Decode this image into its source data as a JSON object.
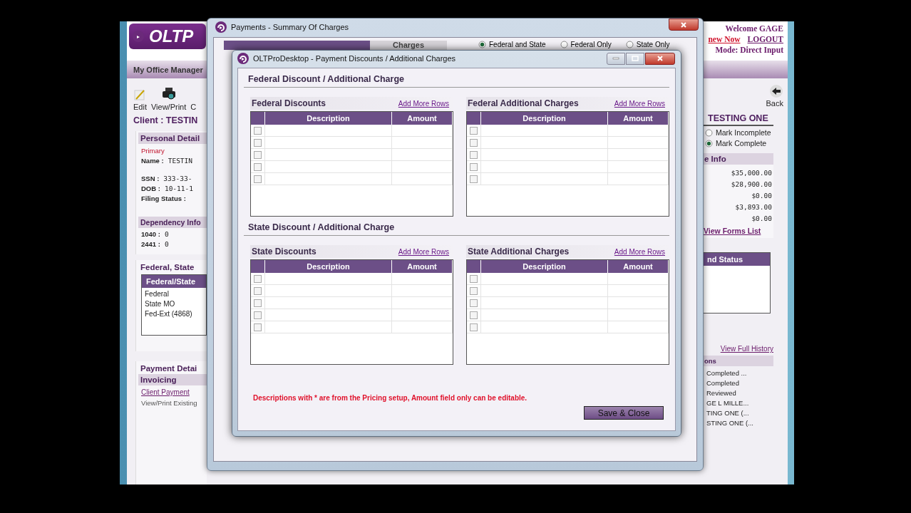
{
  "main": {
    "logo": "OLTP",
    "welcome": "Welcome GAGE",
    "renew_link": "new Now",
    "logout_link": "LOGOUT",
    "mode": "Mode: Direct Input",
    "office_manager": "My Office Manager",
    "toolbar": [
      {
        "label": "Edit",
        "kind": "edit"
      },
      {
        "label": "View/Print",
        "kind": "print"
      },
      {
        "label": "C",
        "kind": "none"
      }
    ],
    "back": "Back",
    "client": "Client : TESTIN",
    "client_name": "TESTING ONE",
    "personal": {
      "title": "Personal Detail",
      "role": "Primary",
      "fields": [
        {
          "label": "Name :",
          "value": "TESTIN"
        },
        {
          "label": "SSN :",
          "value": "333-33-"
        },
        {
          "label": "DOB :",
          "value": "10-11-1"
        },
        {
          "label": "Filing Status :"
        }
      ]
    },
    "dependency": {
      "title": "Dependency Info",
      "rows": [
        {
          "label": "1040 :",
          "value": "0"
        },
        {
          "label": "2441 :",
          "value": "0"
        }
      ]
    },
    "status_options": [
      {
        "label": "Mark Incomplete",
        "selected": false
      },
      {
        "label": "Mark Complete",
        "selected": true
      }
    ],
    "income": {
      "title": "e Info",
      "values": [
        "$35,000.00",
        "$28,900.00",
        "$0.00",
        "$3,893.00",
        "$0.00"
      ],
      "link": "View Forms List"
    },
    "returns": {
      "title": "Federal, State",
      "column": "Federal/State",
      "items": [
        "Federal",
        "State MO",
        "Fed-Ext (4868)"
      ],
      "column_2": "nd Status"
    },
    "payment": {
      "title": "Payment Detai",
      "section": "Invoicing",
      "link": "Client Payment",
      "text": "View/Print Existing"
    },
    "history": {
      "link": "View Full History",
      "title": "ons",
      "items": [
        "Completed ...",
        "Completed",
        "Reviewed",
        "GE L MILLE...",
        "TING ONE (...",
        "STING ONE (..."
      ]
    }
  },
  "summary": {
    "title": "Payments - Summary Of Charges",
    "column": "Charges",
    "options": [
      {
        "label": "Federal and State",
        "selected": true
      },
      {
        "label": "Federal Only",
        "selected": false
      },
      {
        "label": "State Only",
        "selected": false
      }
    ]
  },
  "discounts": {
    "title": "OLTProDesktop - Payment Discounts / Additional Charges",
    "sections": [
      {
        "title": "Federal Discount / Additional Charge",
        "grids": [
          {
            "title": "Federal Discounts",
            "link": "Add More Rows",
            "columns": [
              "Description",
              "Amount"
            ],
            "rows": [
              {
                "checked": false
              },
              {
                "checked": false
              },
              {
                "checked": false
              },
              {
                "checked": false
              },
              {
                "checked": false
              }
            ]
          },
          {
            "title": "Federal Additional Charges",
            "link": "Add More Rows",
            "columns": [
              "Description",
              "Amount"
            ],
            "rows": [
              {
                "checked": false
              },
              {
                "checked": false
              },
              {
                "checked": false
              },
              {
                "checked": false
              },
              {
                "checked": false
              }
            ]
          }
        ]
      },
      {
        "title": "State Discount / Additional Charge",
        "grids": [
          {
            "title": "State Discounts",
            "link": "Add More Rows",
            "columns": [
              "Description",
              "Amount"
            ],
            "rows": [
              {
                "checked": false
              },
              {
                "checked": false
              },
              {
                "checked": false
              },
              {
                "checked": false
              },
              {
                "checked": false
              }
            ]
          },
          {
            "title": "State Additional Charges",
            "link": "Add More Rows",
            "columns": [
              "Description",
              "Amount"
            ],
            "rows": [
              {
                "checked": false
              },
              {
                "checked": false
              },
              {
                "checked": false
              },
              {
                "checked": false
              },
              {
                "checked": false
              }
            ]
          }
        ]
      }
    ],
    "note": "Descriptions with * are from the Pricing setup, Amount field only can be editable.",
    "save_button": "Save & Close"
  }
}
